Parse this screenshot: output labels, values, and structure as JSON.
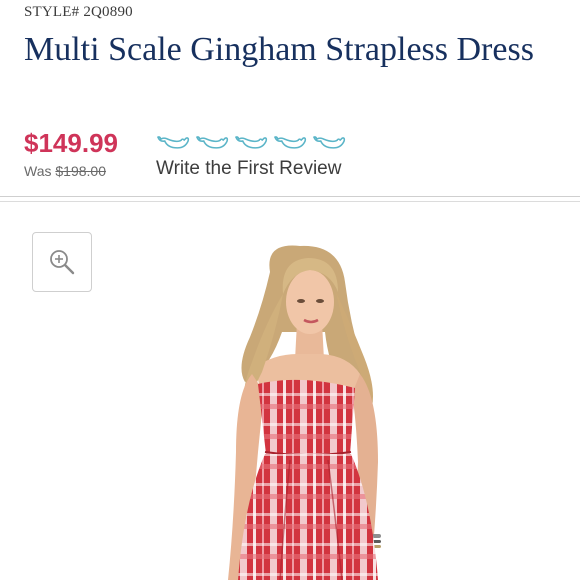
{
  "product": {
    "style_label": "STYLE# 2Q0890",
    "title": "Multi Scale Gingham Strapless Dress",
    "price": "$149.99",
    "was_label": "Was",
    "was_price": "$198.00",
    "rating": {
      "icon": "whale-outline-icon",
      "count": 5,
      "filled": 0,
      "color": "#5bb5c8"
    },
    "review_link": "Write the First Review"
  },
  "image": {
    "zoom_icon": "zoom-in-icon",
    "subject": "model-in-red-gingham-dress"
  },
  "colors": {
    "title": "#17305e",
    "price": "#cf3459",
    "dress_red": "#d2343f"
  }
}
